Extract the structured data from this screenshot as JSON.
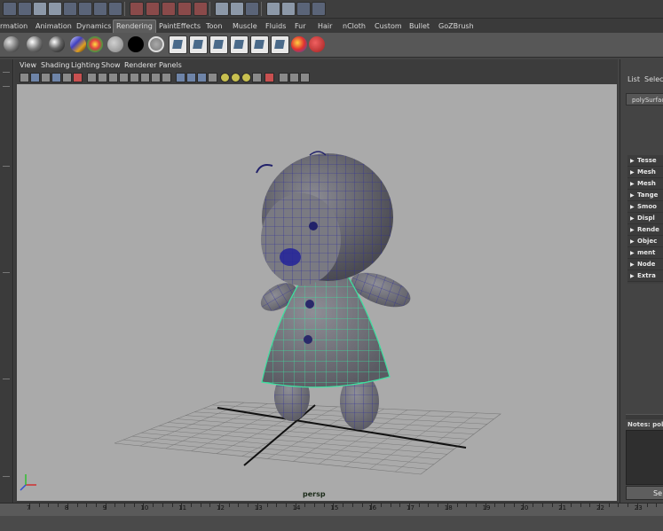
{
  "shelf_tabs": [
    "rmation",
    "Animation",
    "Dynamics",
    "Rendering",
    "PaintEffects",
    "Toon",
    "Muscle",
    "Fluids",
    "Fur",
    "Hair",
    "nCloth",
    "Custom",
    "Bullet",
    "GoZBrush"
  ],
  "active_shelf_tab": "Rendering",
  "panel_menu": [
    "View",
    "Shading",
    "Lighting",
    "Show",
    "Renderer",
    "Panels"
  ],
  "camera_label": "persp",
  "attribute_editor": {
    "tabs": [
      "List",
      "Selecte"
    ],
    "node_name": "polySurface",
    "sections": [
      "Tesse",
      "Mesh",
      "Mesh",
      "Tange",
      "Smoo",
      "Displ",
      "Rende",
      "Objec",
      "ment",
      "Node",
      "Extra"
    ],
    "notes_label": "Notes: pol",
    "select_button": "Se"
  },
  "timeline": {
    "frames": [
      "7",
      "8",
      "9",
      "10",
      "11",
      "12",
      "13",
      "14",
      "15",
      "16",
      "17",
      "18",
      "19",
      "20",
      "21",
      "22",
      "23"
    ]
  },
  "colors": {
    "viewport_bg": "#aaaaaa",
    "wireframe_selected": "#3ee0a0",
    "wireframe_mesh": "#2a2a9a",
    "shelf_bg": "#575757"
  }
}
